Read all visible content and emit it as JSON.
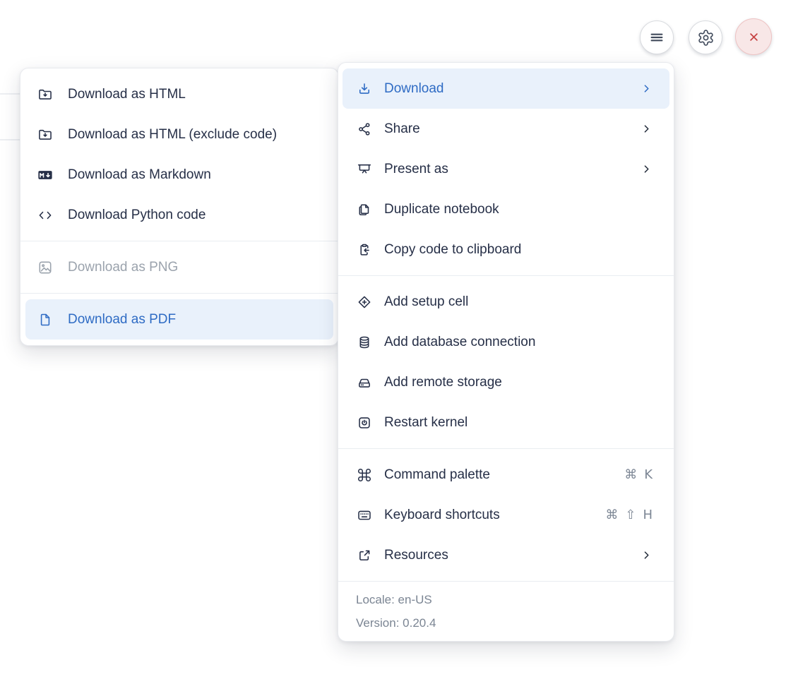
{
  "colors": {
    "accent_blue": "#2e6bc4",
    "highlight_bg": "#e9f1fb",
    "text_dark": "#262f47",
    "disabled_gray": "#9ba3ad",
    "muted_gray": "#7b8593",
    "danger_red": "#c64444",
    "danger_bg": "#f8e7e7"
  },
  "topbar": {
    "buttons": [
      {
        "name": "menu",
        "icon": "hamburger-icon"
      },
      {
        "name": "settings",
        "icon": "gear-icon"
      },
      {
        "name": "close",
        "icon": "close-icon"
      }
    ]
  },
  "submenu": {
    "items": [
      {
        "label": "Download as HTML",
        "icon": "folder-download-icon",
        "state": "normal"
      },
      {
        "label": "Download as HTML (exclude code)",
        "icon": "folder-download-icon",
        "state": "normal"
      },
      {
        "label": "Download as Markdown",
        "icon": "markdown-download-icon",
        "state": "normal"
      },
      {
        "label": "Download Python code",
        "icon": "code-icon",
        "state": "normal"
      },
      {
        "label": "Download as PNG",
        "icon": "image-icon",
        "state": "disabled"
      },
      {
        "label": "Download as PDF",
        "icon": "file-icon",
        "state": "selected"
      }
    ]
  },
  "main_menu": {
    "sections": [
      {
        "items": [
          {
            "label": "Download",
            "icon": "download-icon",
            "state": "selected",
            "has_submenu": true
          },
          {
            "label": "Share",
            "icon": "share-icon",
            "state": "normal",
            "has_submenu": true
          },
          {
            "label": "Present as",
            "icon": "presentation-icon",
            "state": "normal",
            "has_submenu": true
          },
          {
            "label": "Duplicate notebook",
            "icon": "duplicate-icon",
            "state": "normal"
          },
          {
            "label": "Copy code to clipboard",
            "icon": "clipboard-copy-icon",
            "state": "normal"
          }
        ]
      },
      {
        "items": [
          {
            "label": "Add setup cell",
            "icon": "plus-diamond-icon",
            "state": "normal"
          },
          {
            "label": "Add database connection",
            "icon": "database-icon",
            "state": "normal"
          },
          {
            "label": "Add remote storage",
            "icon": "storage-drive-icon",
            "state": "normal"
          },
          {
            "label": "Restart kernel",
            "icon": "power-icon",
            "state": "normal"
          }
        ]
      },
      {
        "items": [
          {
            "label": "Command palette",
            "icon": "command-icon",
            "shortcut": [
              "⌘",
              "K"
            ]
          },
          {
            "label": "Keyboard shortcuts",
            "icon": "keyboard-icon",
            "shortcut": [
              "⌘",
              "⇧",
              "H"
            ]
          },
          {
            "label": "Resources",
            "icon": "external-link-icon",
            "has_submenu": true
          }
        ]
      }
    ],
    "footer": {
      "locale": "Locale: en-US",
      "version": "Version: 0.20.4"
    }
  }
}
